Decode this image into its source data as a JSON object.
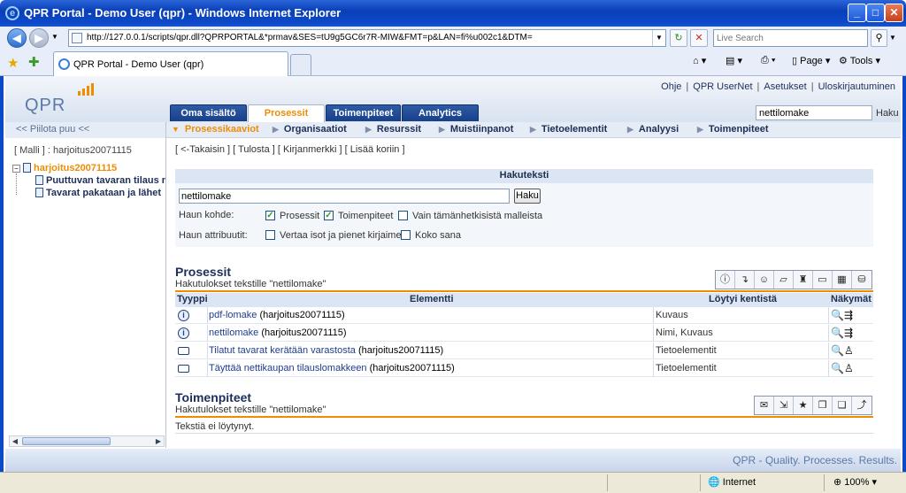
{
  "window": {
    "title": "QPR Portal - Demo User (qpr) - Windows Internet Explorer",
    "minimize": "_",
    "maximize": "□",
    "close": "✕"
  },
  "browser": {
    "url": "http://127.0.0.1/scripts/qpr.dll?QPRPORTAL&*prmav&SES=tU9g5GC6r7R-MIW&FMT=p&LAN=fi%u002c1&DTM=",
    "search_placeholder": "Live Search",
    "tab_label": "QPR Portal - Demo User (qpr)",
    "commands": {
      "page": "Page",
      "tools": "Tools"
    },
    "icons": [
      "back-icon",
      "forward-icon",
      "refresh-icon",
      "stop-icon",
      "search-icon",
      "favorites-star-icon",
      "add-favorite-icon",
      "home-icon",
      "feeds-icon",
      "print-icon",
      "gear-icon"
    ]
  },
  "app": {
    "logo": "QPR",
    "top_links": [
      "Ohje",
      "QPR UserNet",
      "Asetukset",
      "Uloskirjautuminen"
    ],
    "tabs": [
      {
        "label": "Oma sisältö",
        "active": false
      },
      {
        "label": "Prosessit",
        "active": true
      },
      {
        "label": "Toimenpiteet",
        "active": false
      },
      {
        "label": "Analytics",
        "active": false
      }
    ],
    "header_search_value": "nettilomake",
    "header_search_button": "Haku",
    "accent_color": "#f08c00",
    "nav_color": "#1d2f58"
  },
  "left": {
    "hide_tree": "<< Piilota puu <<",
    "model_line": "[ Malli ] : harjoitus20071115",
    "tree": {
      "root": "harjoitus20071115",
      "children": [
        "Puuttuvan tavaran tilaus r",
        "Tavarat pakataan ja lähet"
      ]
    }
  },
  "subnav": [
    {
      "label": "Prosessikaaviot",
      "active": true
    },
    {
      "label": "Organisaatiot",
      "active": false
    },
    {
      "label": "Resurssit",
      "active": false
    },
    {
      "label": "Muistiinpanot",
      "active": false
    },
    {
      "label": "Tietoelementit",
      "active": false
    },
    {
      "label": "Analyysi",
      "active": false
    },
    {
      "label": "Toimenpiteet",
      "active": false
    }
  ],
  "actions": "[ <-Takaisin ] [ Tulosta ] [ Kirjanmerkki ] [ Lisää koriin ]",
  "search_panel": {
    "title": "Hakuteksti",
    "value": "nettilomake",
    "button": "Haku",
    "target_label": "Haun kohde:",
    "attr_label": "Haun attribuutit:",
    "options": [
      {
        "label": "Prosessit",
        "checked": true
      },
      {
        "label": "Toimenpiteet",
        "checked": true
      },
      {
        "label": "Vain tämänhetkisistä malleista",
        "checked": false
      },
      {
        "label": "Vertaa isot ja pienet kirjaimet",
        "checked": false
      },
      {
        "label": "Koko sana",
        "checked": false
      }
    ]
  },
  "processes": {
    "title": "Prosessit",
    "subtitle": "Hakutulokset tekstille \"nettilomake\"",
    "columns": [
      "Tyyppi",
      "Elementti",
      "Löytyi kentistä",
      "Näkymät"
    ],
    "rows": [
      {
        "type": "info",
        "link": "pdf-lomake",
        "model": "(harjoitus20071115)",
        "found": "Kuvaus"
      },
      {
        "type": "info",
        "link": "nettilomake",
        "model": "(harjoitus20071115)",
        "found": "Nimi, Kuvaus"
      },
      {
        "type": "rect",
        "link": "Tilatut tavarat kerätään varastosta",
        "model": "(harjoitus20071115)",
        "found": "Tietoelementit"
      },
      {
        "type": "rect",
        "link": "Täyttää nettikaupan tilauslomakkeen",
        "model": "(harjoitus20071115)",
        "found": "Tietoelementit"
      }
    ]
  },
  "measures": {
    "title": "Toimenpiteet",
    "subtitle": "Hakutulokset tekstille \"nettilomake\"",
    "empty": "Tekstiä ei löytynyt."
  },
  "footer": "QPR - Quality. Processes. Results.",
  "status": {
    "zone": "Internet",
    "zoom": "100%"
  }
}
